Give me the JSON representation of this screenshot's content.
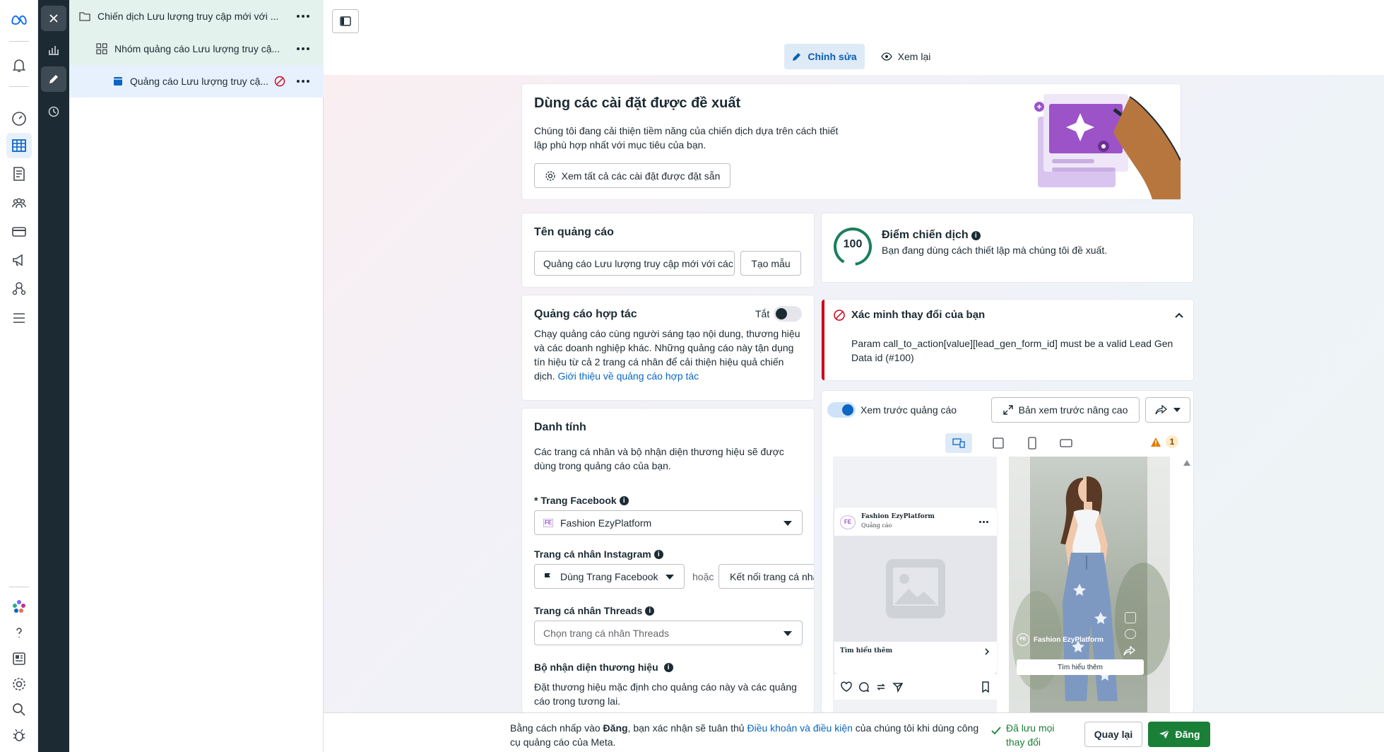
{
  "tree": {
    "campaign": "Chiến dịch Lưu lượng truy cập mới với ...",
    "adset": "Nhóm quảng cáo Lưu lượng truy cậ...",
    "ad": "Quảng cáo Lưu lượng truy cậ..."
  },
  "topbar": {
    "edit_label": "Chỉnh sửa",
    "review_label": "Xem lại"
  },
  "recommended": {
    "title": "Dùng các cài đặt được đề xuất",
    "desc": "Chúng tôi đang cải thiện tiềm năng của chiến dịch dựa trên cách thiết lập phù hợp nhất với mục tiêu của bạn.",
    "button": "Xem tất cả các cài đặt được đặt sẵn"
  },
  "ad_name": {
    "title": "Tên quảng cáo",
    "value": "Quảng cáo Lưu lượng truy cập mới với các",
    "template_button": "Tạo mẫu"
  },
  "score": {
    "value": "100",
    "title": "Điểm chiến dịch",
    "desc": "Bạn đang dùng cách thiết lập mà chúng tôi đề xuất."
  },
  "partnership": {
    "title": "Quảng cáo hợp tác",
    "toggle_label": "Tắt",
    "desc": "Chạy quảng cáo cùng người sáng tạo nội dung, thương hiệu và các doanh nghiệp khác. Những quảng cáo này tận dụng tín hiệu từ cả 2 trang cá nhân để cải thiện hiệu quả chiến dịch.",
    "link": "Giới thiệu về quảng cáo hợp tác"
  },
  "verify": {
    "title": "Xác minh thay đổi của bạn",
    "message": "Param call_to_action[value][lead_gen_form_id] must be a valid Lead Gen Data id (#100)"
  },
  "identity": {
    "title": "Danh tính",
    "desc": "Các trang cá nhân và bộ nhận diện thương hiệu sẽ được dùng trong quảng cáo của bạn.",
    "facebook_label": "* Trang Facebook",
    "facebook_value": "Fashion EzyPlatform",
    "instagram_label": "Trang cá nhân Instagram",
    "instagram_value": "Dùng Trang Facebook",
    "or_text": "hoặc",
    "connect_button": "Kết nối trang cá nhân",
    "threads_label": "Trang cá nhân Threads",
    "threads_placeholder": "Chọn trang cá nhân Threads",
    "brand_label": "Bộ nhận diện thương hiệu",
    "brand_desc": "Đặt thương hiệu mặc định cho quảng cáo này và các quảng cáo trong tương lai."
  },
  "preview": {
    "toggle_label": "Xem trước quảng cáo",
    "advanced_button": "Bản xem trước nâng cao",
    "warning_count": "1",
    "page_name": "Fashion EzyPlatform",
    "sponsored": "Quảng cáo",
    "cta": "Tìm hiểu thêm",
    "reel_page_name": "Fashion EzyPlatform",
    "reel_cta": "Tìm hiểu thêm"
  },
  "footer": {
    "text_prefix": "Bằng cách nhấp vào ",
    "text_bold": "Đăng",
    "text_mid": ", bạn xác nhận sẽ tuân thủ ",
    "text_link": "Điều khoản và điều kiện",
    "text_suffix": " của chúng tôi khi dùng công cụ quảng cáo của Meta.",
    "saved_label": "Đã lưu mọi thay đổi",
    "back_button": "Quay lại",
    "publish_button": "Đăng"
  },
  "colors": {
    "accent": "#0a66c2",
    "publish": "#1a7f37",
    "dark_rail": "#1c2b33",
    "error": "#d0021b",
    "score_ring": "#1a7f5a"
  }
}
